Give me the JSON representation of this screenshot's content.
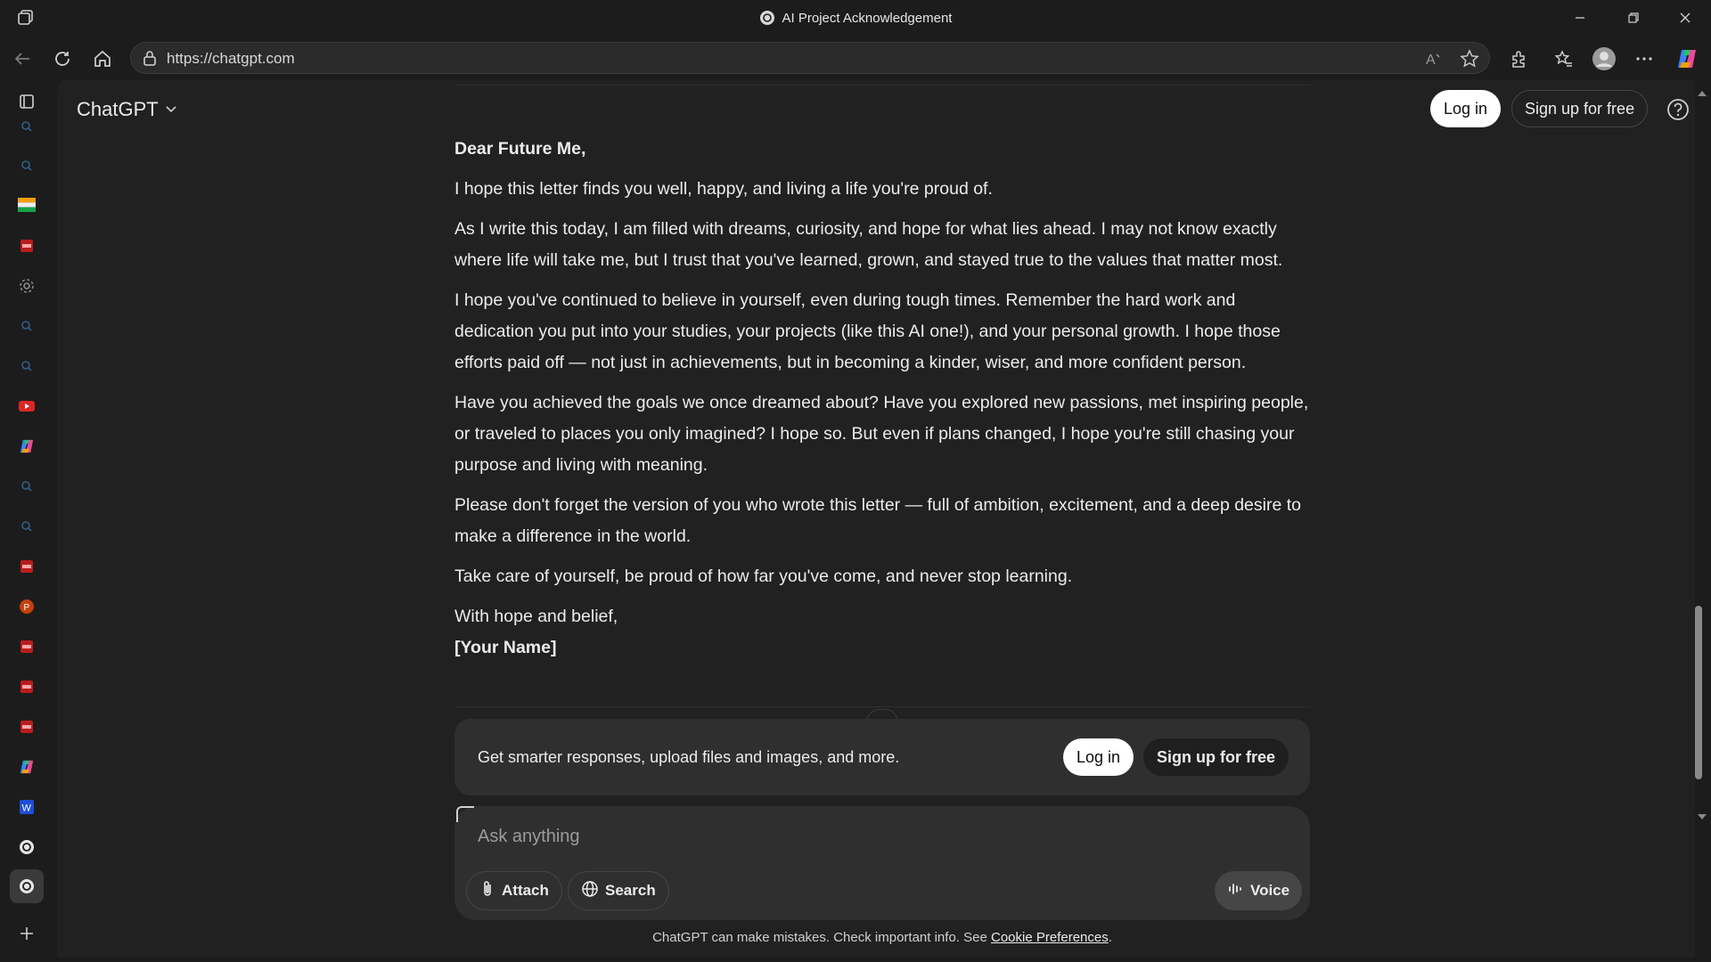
{
  "window": {
    "title": "AI Project Acknowledgement"
  },
  "browser": {
    "url": "https://chatgpt.com"
  },
  "header": {
    "brand": "ChatGPT",
    "login_label": "Log in",
    "signup_label": "Sign up for free"
  },
  "letter": {
    "greeting": "Dear Future Me,",
    "paragraphs": [
      "I hope this letter finds you well, happy, and living a life you're proud of.",
      "As I write this today, I am filled with dreams, curiosity, and hope for what lies ahead. I may not know exactly where life will take me, but I trust that you've learned, grown, and stayed true to the values that matter most.",
      "I hope you've continued to believe in yourself, even during tough times. Remember the hard work and dedication you put into your studies, your projects (like this AI one!), and your personal growth. I hope those efforts paid off — not just in achievements, but in becoming a kinder, wiser, and more confident person.",
      "Have you achieved the goals we once dreamed about? Have you explored new passions, met inspiring people, or traveled to places you only imagined? I hope so. But even if plans changed, I hope you're still chasing your purpose and living with meaning.",
      "Please don't forget the version of you who wrote this letter — full of ambition, excitement, and a deep desire to make a difference in the world.",
      "Take care of yourself, be proud of how far you've come, and never stop learning."
    ],
    "closing": "With hope and belief,",
    "signature": "[Your Name]"
  },
  "promo": {
    "text": "Get smarter responses, upload files and images, and more.",
    "login_label": "Log in",
    "signup_label": "Sign up for free"
  },
  "composer": {
    "placeholder": "Ask anything",
    "attach_label": "Attach",
    "search_label": "Search",
    "voice_label": "Voice"
  },
  "footer": {
    "disclaimer": "ChatGPT can make mistakes. Check important info. See",
    "link": "Cookie Preferences",
    "end": "."
  },
  "sidebar_icons": [
    "tab-actions-icon",
    "search-icon",
    "search-icon",
    "india-flag-icon",
    "pdf-icon",
    "settings-icon",
    "search-icon",
    "search-icon",
    "youtube-icon",
    "copilot-icon",
    "search-icon",
    "search-icon",
    "pdf-icon",
    "powerpoint-icon",
    "pdf-icon",
    "pdf-icon",
    "pdf-icon",
    "copilot-icon",
    "word-icon",
    "chatgpt-icon",
    "chatgpt-icon",
    "add-icon"
  ],
  "colors": {
    "background": "#212121",
    "chrome": "#1c1c1c",
    "surface": "#2f2f2f",
    "text": "#ececec",
    "button_light": "#ffffff"
  }
}
